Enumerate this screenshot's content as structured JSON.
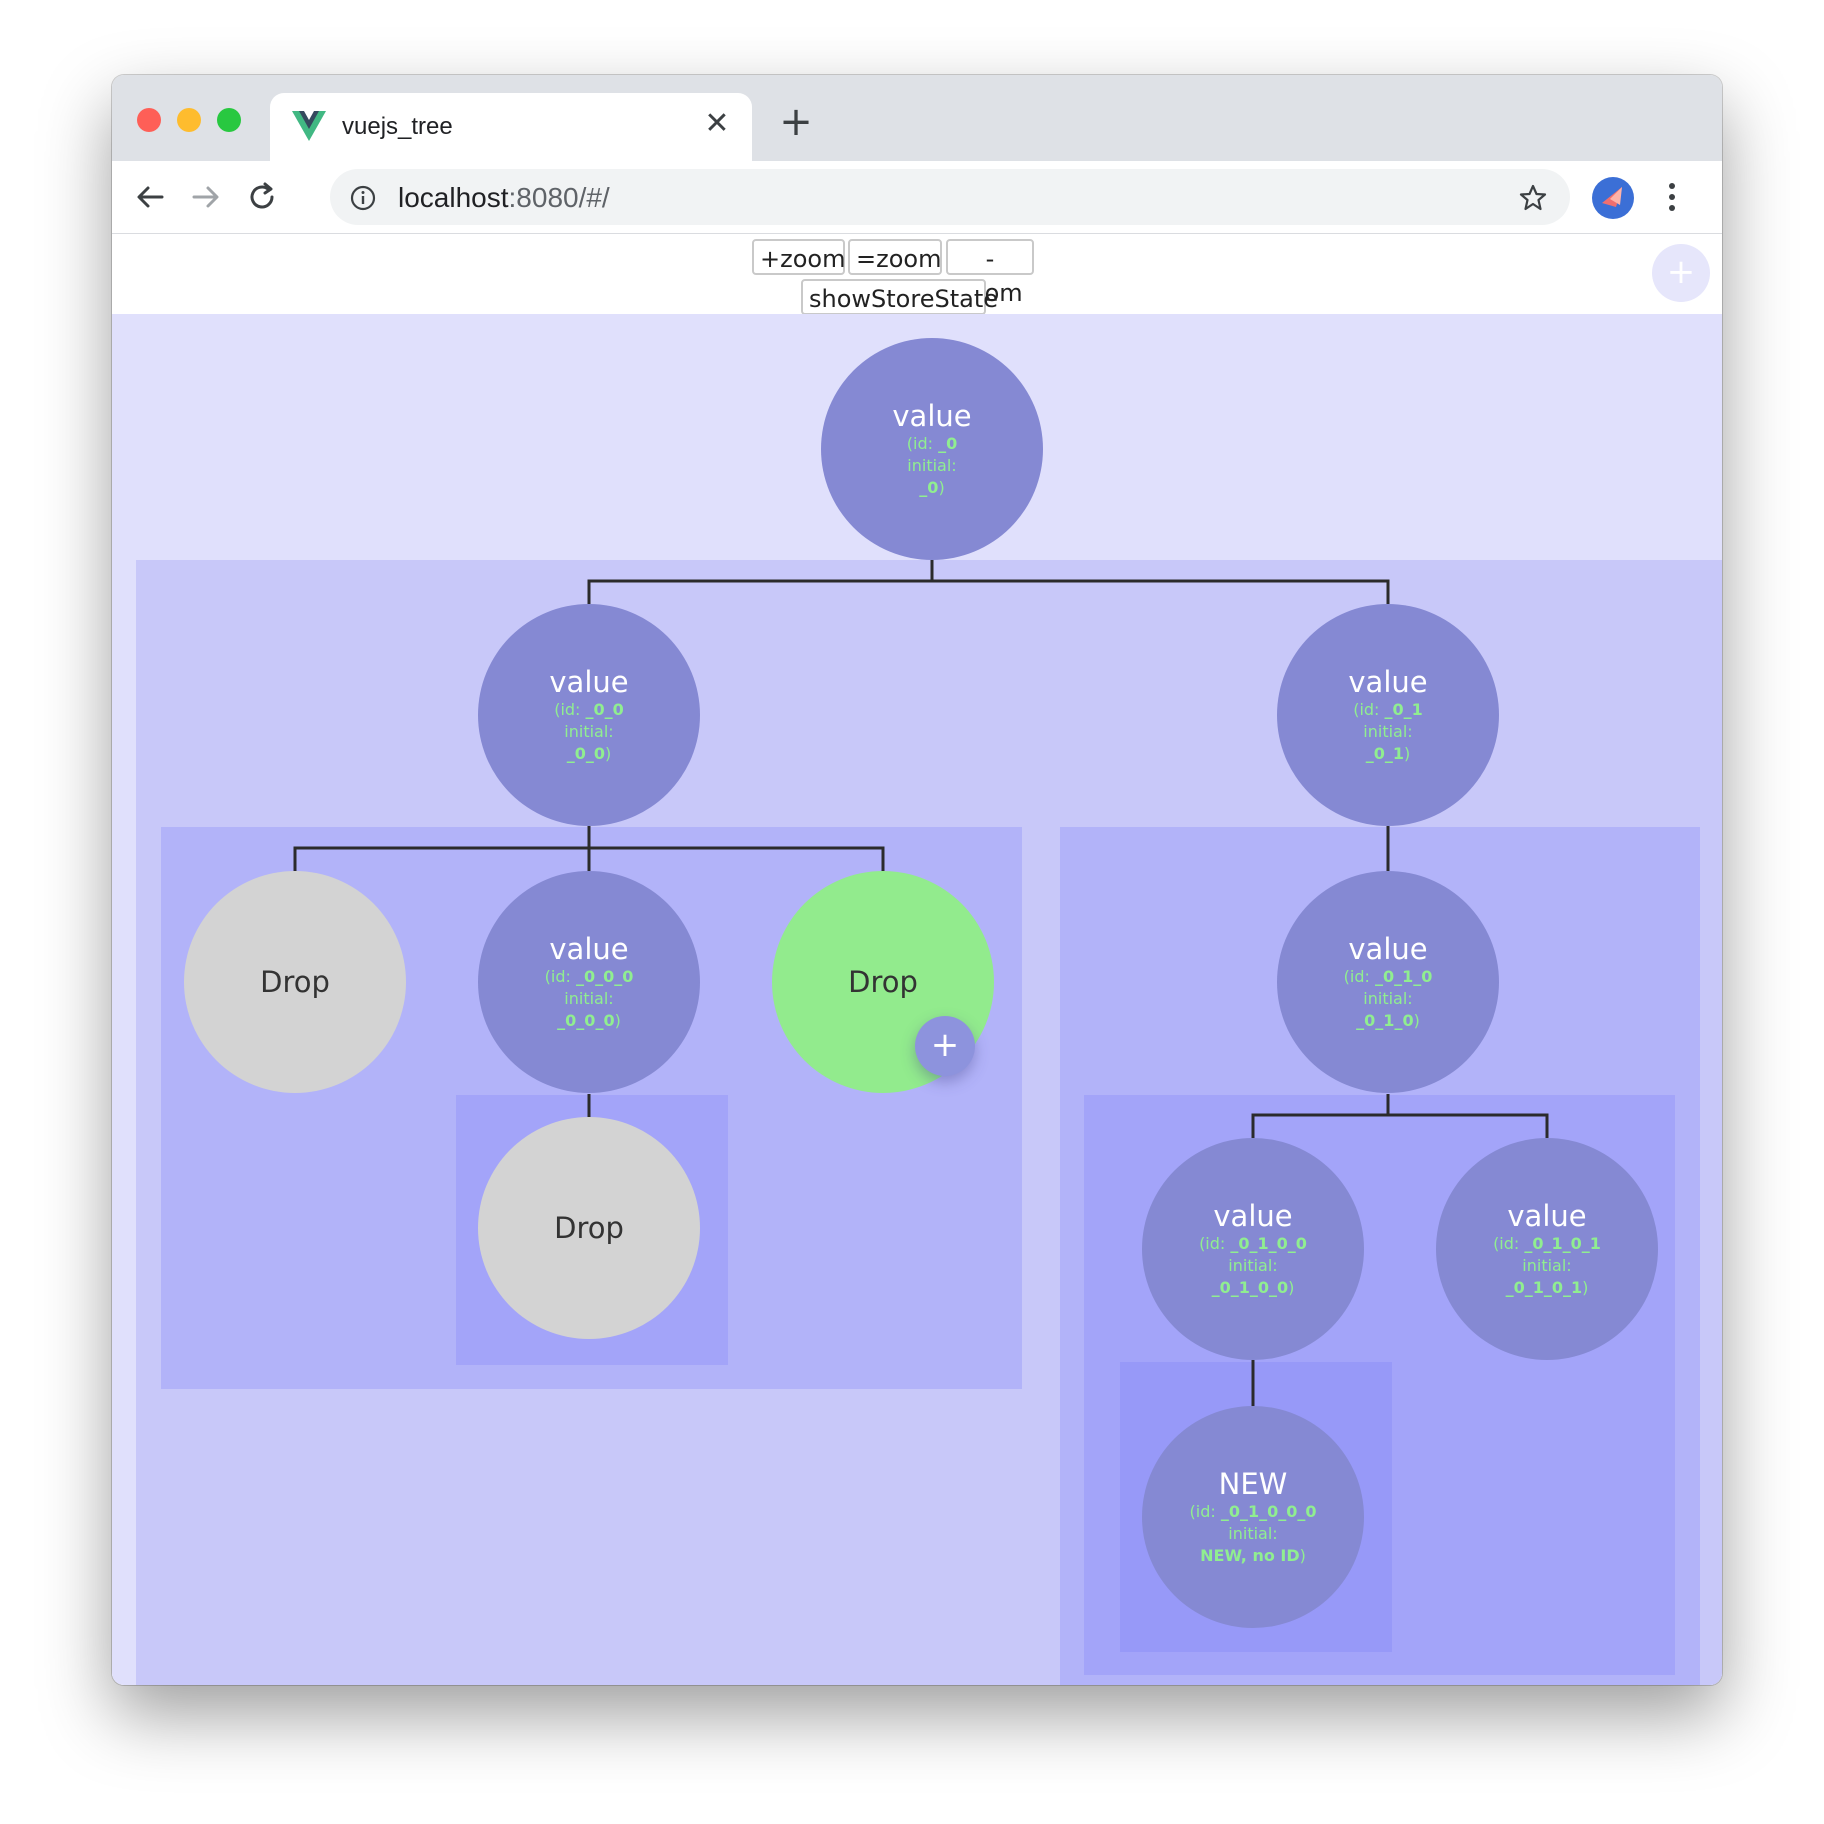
{
  "browser": {
    "tab_title": "vuejs_tree",
    "tab_close_glyph": "✕",
    "new_tab_glyph": "+",
    "url_host": "localhost",
    "url_rest": ":8080/#/",
    "icons": [
      "back-icon",
      "forward-icon",
      "reload-icon",
      "info-icon",
      "star-icon",
      "profile-avatar",
      "menu-dots-icon",
      "vue-logo-icon"
    ]
  },
  "controls": {
    "zoom_in": "+zoom",
    "zoom_reset": "=zoom",
    "zoom_out": "-zoom",
    "show_state": "showStoreState",
    "add_glyph": "+"
  },
  "colors": {
    "node": "#8589d3",
    "drop_gray": "#d3d3d3",
    "drop_green": "#92eb8d",
    "id_text": "#90ee90"
  },
  "tree": {
    "id_prefix": "(id: ",
    "initial_prefix": "initial:",
    "close_paren": ")",
    "n0": {
      "label": "value",
      "id": "_0",
      "initial": "_0"
    },
    "n00": {
      "label": "value",
      "id": "_0_0",
      "initial": "_0_0"
    },
    "n01": {
      "label": "value",
      "id": "_0_1",
      "initial": "_0_1"
    },
    "n000": {
      "label": "value",
      "id": "_0_0_0",
      "initial": "_0_0_0"
    },
    "n010": {
      "label": "value",
      "id": "_0_1_0",
      "initial": "_0_1_0"
    },
    "n0100": {
      "label": "value",
      "id": "_0_1_0_0",
      "initial": "_0_1_0_0"
    },
    "n0101": {
      "label": "value",
      "id": "_0_1_0_1",
      "initial": "_0_1_0_1"
    },
    "n01000": {
      "label": "NEW",
      "id": "_0_1_0_0_0",
      "initial": "NEW, no ID"
    },
    "drop_label": "Drop",
    "node_add_glyph": "+"
  }
}
